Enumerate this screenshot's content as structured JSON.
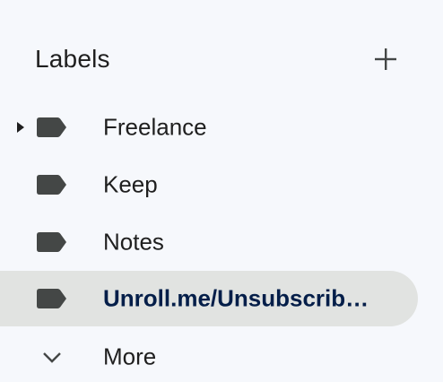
{
  "labels": {
    "title": "Labels",
    "add_icon": "plus-icon",
    "items": [
      {
        "label": "Freelance",
        "icon": "label-tag-icon",
        "has_children": true,
        "active": false
      },
      {
        "label": "Keep",
        "icon": "label-tag-icon",
        "has_children": false,
        "active": false
      },
      {
        "label": "Notes",
        "icon": "label-tag-icon",
        "has_children": false,
        "active": false
      },
      {
        "label": "Unroll.me/Unsubscrib…",
        "icon": "label-tag-icon",
        "has_children": false,
        "active": true
      }
    ],
    "more": {
      "label": "More",
      "icon": "chevron-down-icon"
    }
  },
  "colors": {
    "background": "#f6f8fc",
    "active_row": "#e1e3e1",
    "active_text": "#041e49",
    "text": "#1f1f1f",
    "icon": "#444746"
  }
}
